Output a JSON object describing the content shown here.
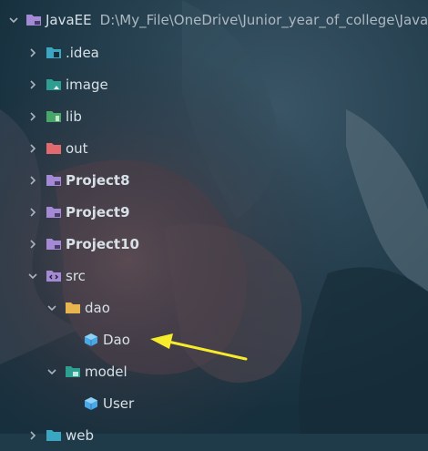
{
  "colors": {
    "folder_purple": "#a48ad4",
    "folder_teal": "#2d9e90",
    "folder_yellow": "#e7b54f",
    "folder_red": "#e06a6e",
    "folder_green": "#48a66a",
    "folder_cyan": "#3ba6c2",
    "class_blue": "#4aa8e6",
    "arrow_yellow": "#f7ec2b"
  },
  "project": {
    "name": "JavaEE",
    "path": "D:\\My_File\\OneDrive\\Junior_year_of_college\\JavaEE"
  },
  "tree": {
    "idea": ".idea",
    "image": "image",
    "lib": "lib",
    "out": "out",
    "project8": "Project8",
    "project9": "Project9",
    "project10": "Project10",
    "src": "src",
    "dao": "dao",
    "dao_class": "Dao",
    "model": "model",
    "user_class": "User",
    "web": "web"
  }
}
